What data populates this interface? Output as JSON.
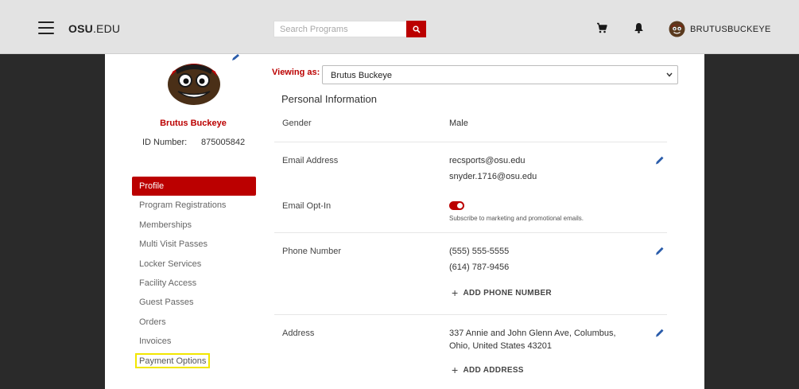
{
  "header": {
    "brand_bold": "OSU",
    "brand_rest": ".EDU",
    "search_placeholder": "Search Programs",
    "username": "BRUTUSBUCKEYE"
  },
  "profile": {
    "name": "Brutus Buckeye",
    "id_label": "ID Number:",
    "id_value": "875005842"
  },
  "nav": {
    "items": [
      "Profile",
      "Program Registrations",
      "Memberships",
      "Multi Visit Passes",
      "Locker Services",
      "Facility Access",
      "Guest Passes",
      "Orders",
      "Invoices",
      "Payment Options"
    ],
    "active_index": 0,
    "highlighted_index": 9
  },
  "viewing": {
    "label": "Viewing as:",
    "selected": "Brutus Buckeye"
  },
  "personal": {
    "title": "Personal Information",
    "gender_label": "Gender",
    "gender_value": "Male",
    "email_label": "Email Address",
    "emails": [
      "recsports@osu.edu",
      "snyder.1716@osu.edu"
    ],
    "optin_label": "Email Opt-In",
    "optin_caption": "Subscribe to marketing and promotional emails.",
    "optin_enabled": true,
    "phone_label": "Phone Number",
    "phones": [
      "(555) 555-5555",
      "(614) 787-9456"
    ],
    "add_phone": "ADD PHONE NUMBER",
    "address_label": "Address",
    "address_line1": "337 Annie and John Glenn Ave, Columbus,",
    "address_line2": "Ohio, United States 43201",
    "add_address": "ADD ADDRESS"
  },
  "colors": {
    "accent": "#bb0000",
    "highlight": "#f2e600",
    "topbar": "#e3e3e3",
    "backdrop": "#2a2a2a"
  },
  "icons": [
    "menu-icon",
    "search-icon",
    "cart-icon",
    "bell-icon",
    "pencil-icon",
    "chevron-down-icon",
    "plus-icon"
  ]
}
